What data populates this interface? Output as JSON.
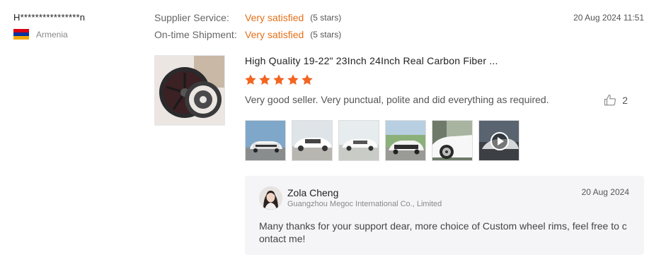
{
  "reviewer": {
    "name": "H****************n",
    "country": "Armenia",
    "flag_colors": [
      "#d90012",
      "#0033a0",
      "#f2a800"
    ]
  },
  "ratings": [
    {
      "label": "Supplier Service:",
      "value": "Very satisfied",
      "stars": "(5 stars)"
    },
    {
      "label": "On-time Shipment:",
      "value": "Very satisfied",
      "stars": "(5 stars)"
    }
  ],
  "review_date": "20 Aug 2024 11:51",
  "product": {
    "title": "High Quality 19-22\" 23Inch 24Inch Real Carbon Fiber ...",
    "rating": 5
  },
  "review_text": "Very good seller. Very punctual, polite and did everything as required.",
  "likes": "2",
  "gallery_count": 6,
  "reply": {
    "name": "Zola Cheng",
    "company": "Guangzhou Megoc International Co., Limited",
    "date": "20 Aug 2024",
    "text": "Many thanks for your support dear, more choice of Custom wheel rims, feel free to contact me!"
  },
  "colors": {
    "accent": "#e5701a",
    "star": "#f26522",
    "reply_bg": "#f5f5f7"
  },
  "icons": [
    "thumbs-up-icon",
    "play-icon",
    "star-icon"
  ]
}
